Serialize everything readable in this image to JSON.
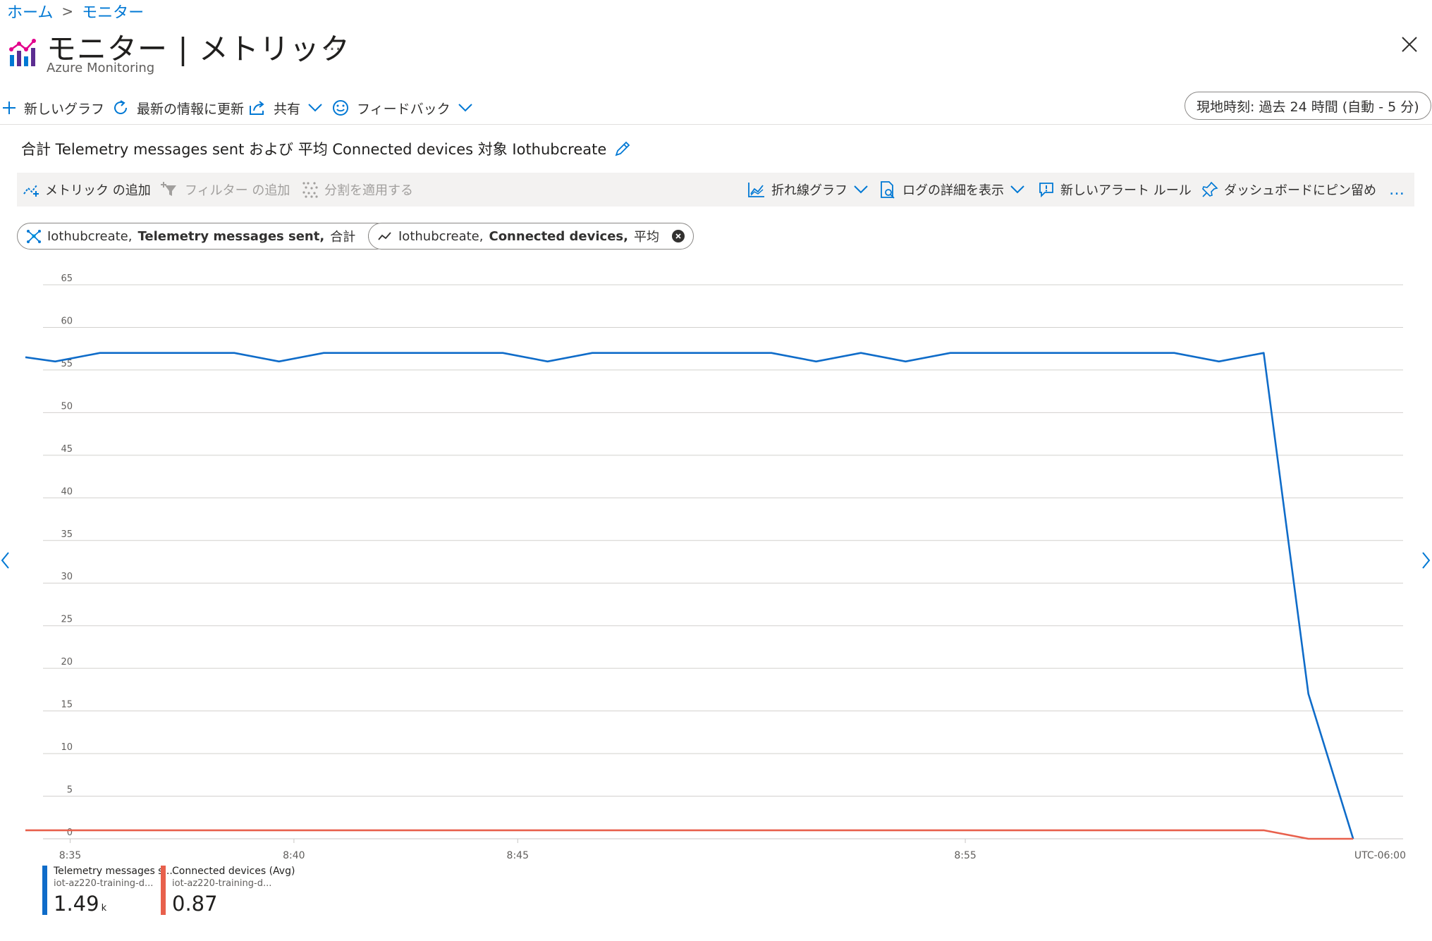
{
  "breadcrumb": {
    "home": "ホーム",
    "current": "モニター"
  },
  "header": {
    "title": "モニター | メトリック",
    "subtitle": "Azure Monitoring",
    "more": "…"
  },
  "commandbar": {
    "new_chart": "新しいグラフ",
    "refresh": "最新の情報に更新",
    "share": "共有",
    "feedback": "フィードバック",
    "time_range": "現地時刻: 過去 24 時間 (自動 - 5 分)"
  },
  "chart_header": {
    "title": "合計 Telemetry messages sent および 平均 Connected devices 対象 Iothubcreate"
  },
  "chart_toolbar": {
    "add_metric": "メトリック の追加",
    "add_filter": "フィルター の追加",
    "apply_split": "分割を適用する",
    "line_chart": "折れ線グラフ",
    "view_logs": "ログの詳細を表示",
    "new_alert": "新しいアラート ルール",
    "pin_dashboard": "ダッシュボードにピン留め",
    "more": "…"
  },
  "metric_pills": [
    {
      "resource": "Iothubcreate,",
      "metric": "Telemetry messages sent,",
      "agg": "合計"
    },
    {
      "resource": "Iothubcreate,",
      "metric": "Connected devices,",
      "agg": "平均"
    }
  ],
  "colors": {
    "accent": "#0078d4",
    "series1": "#0f6cc9",
    "series2": "#e8604c",
    "grid": "#d2d0ce"
  },
  "chart_data": {
    "type": "line",
    "ylim": [
      0,
      65
    ],
    "yticks": [
      "0",
      "5",
      "10",
      "15",
      "20",
      "25",
      "30",
      "35",
      "40",
      "45",
      "50",
      "55",
      "60",
      "65"
    ],
    "xlim": [
      0,
      61.5
    ],
    "xtick_labels": [
      {
        "label": "8:35",
        "t": 2
      },
      {
        "label": "8:40",
        "t": 12
      },
      {
        "label": "8:45",
        "t": 22
      },
      {
        "label": "8:55",
        "t": 42
      }
    ],
    "timezone_label": "UTC-06:00",
    "x_minutes_after_8_33": [
      0,
      1.3333,
      3.3333,
      5.3333,
      7.3333,
      9.3333,
      11.3333,
      13.3333,
      15.3333,
      17.3333,
      19.3333,
      21.3333,
      23.3333,
      25.3333,
      27.3333,
      29.3333,
      31.3333,
      33.3333,
      35.3333,
      37.3333,
      39.3333,
      41.3333,
      43.3333,
      45.3333,
      47.3333,
      49.3333,
      51.3333,
      53.3333,
      55.3333,
      57.3333,
      59.3333
    ],
    "series": [
      {
        "name": "Telemetry messages s...",
        "values": [
          56.5,
          56,
          57,
          57,
          57,
          57,
          56,
          57,
          57,
          57,
          57,
          57,
          56,
          57,
          57,
          57,
          57,
          57,
          56,
          57,
          56,
          57,
          57,
          57,
          57,
          57,
          57,
          56,
          57,
          17,
          0
        ]
      },
      {
        "name": "Connected devices (Avg)",
        "values": [
          1,
          1,
          1,
          1,
          1,
          1,
          1,
          1,
          1,
          1,
          1,
          1,
          1,
          1,
          1,
          1,
          1,
          1,
          1,
          1,
          1,
          1,
          1,
          1,
          1,
          1,
          1,
          1,
          1,
          0,
          0
        ]
      }
    ]
  },
  "legend": [
    {
      "title": "Telemetry messages s...",
      "resource": "iot-az220-training-d...",
      "value": "1.49",
      "unit": "k"
    },
    {
      "title": "Connected devices (Avg)",
      "resource": "iot-az220-training-d...",
      "value": "0.87",
      "unit": ""
    }
  ]
}
